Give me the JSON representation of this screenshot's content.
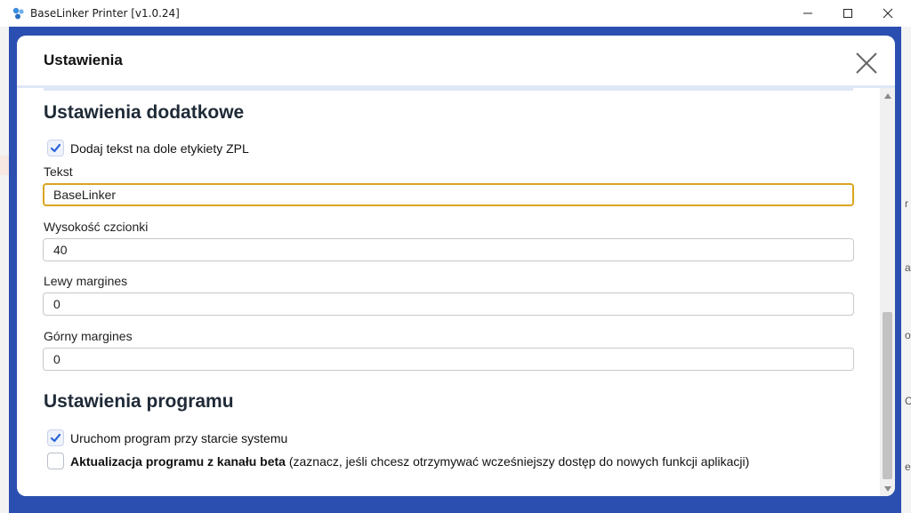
{
  "window": {
    "title": "BaseLinker Printer [v1.0.24]"
  },
  "modal": {
    "title": "Ustawienia"
  },
  "sections": {
    "additional": {
      "title": "Ustawienia dodatkowe",
      "add_text_checkbox": {
        "label": "Dodaj tekst na dole etykiety ZPL",
        "checked": true
      },
      "text_field": {
        "label": "Tekst",
        "value": "BaseLinker"
      },
      "font_height_field": {
        "label": "Wysokość czcionki",
        "value": "40"
      },
      "left_margin_field": {
        "label": "Lewy margines",
        "value": "0"
      },
      "top_margin_field": {
        "label": "Górny margines",
        "value": "0"
      }
    },
    "program": {
      "title": "Ustawienia programu",
      "autostart_checkbox": {
        "label": "Uruchom program przy starcie systemu",
        "checked": true
      },
      "beta_checkbox": {
        "label_bold": "Aktualizacja programu z kanału beta",
        "label_note": " (zaznacz, jeśli chcesz otrzymywać wcześniejszy dostęp do nowych funkcji aplikacji)",
        "checked": false
      }
    }
  },
  "background_edge_glyphs": [
    "r",
    "a",
    "o",
    "C",
    "e"
  ],
  "icons": {
    "app": "baselinker-app-icon",
    "minimize": "minimize-icon",
    "maximize": "maximize-icon",
    "close_window": "close-window-icon",
    "close_modal": "close-icon",
    "check": "checkmark-icon"
  },
  "colors": {
    "app_background": "#2b4fb0",
    "checkbox_check": "#2b64d9",
    "focus_border": "#d9a520"
  }
}
